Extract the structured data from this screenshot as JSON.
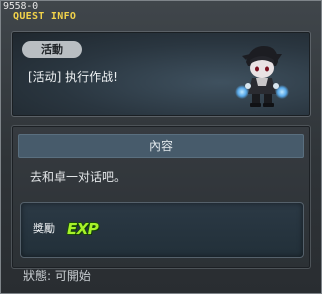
{
  "window": {
    "quest_id": "9558-0",
    "title": "QUEST INFO"
  },
  "quest": {
    "tag": "活動",
    "name": "[活动] 执行作战!",
    "npc_icon": "npc-character-icon"
  },
  "content": {
    "header": "內容",
    "text": "去和卓一对话吧。"
  },
  "reward": {
    "label": "獎勵",
    "exp_text": "EXP",
    "exp_color": "#a7f229"
  },
  "status": {
    "text": "狀態:  可開始"
  },
  "colors": {
    "title": "#f2d34a",
    "header_bg": "#475b6b",
    "tag_bg": "#b9bec2"
  }
}
